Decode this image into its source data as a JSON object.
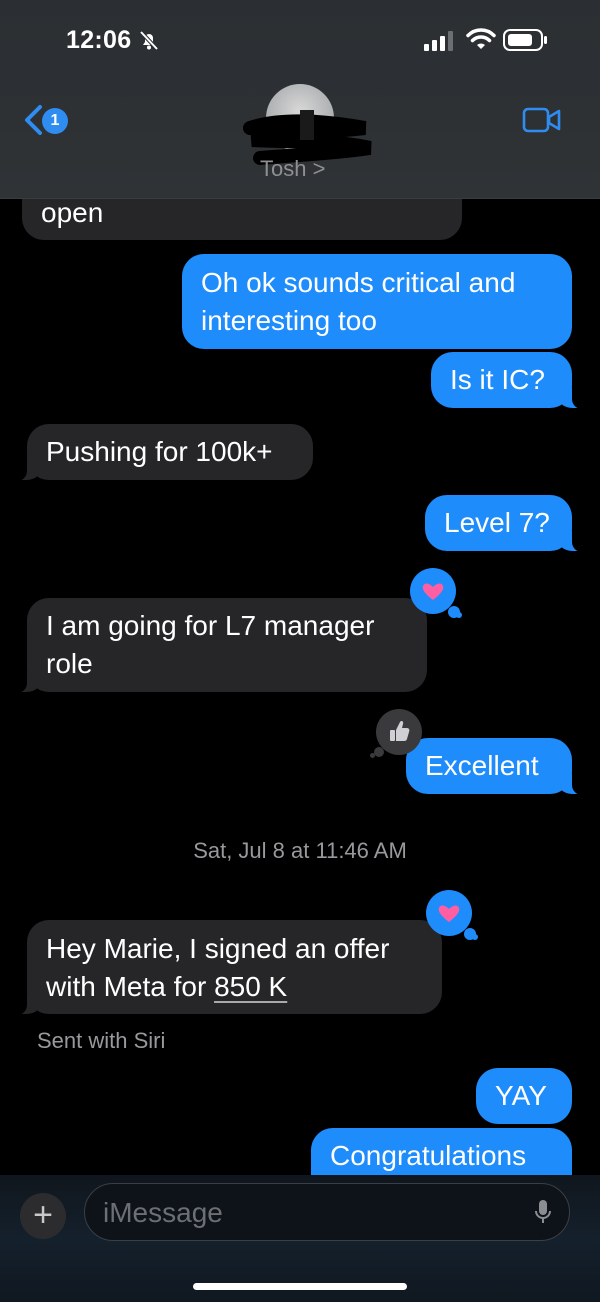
{
  "status_bar": {
    "time": "12:06"
  },
  "header": {
    "back_badge": "1",
    "contact_name": "Tosh >"
  },
  "messages": [
    {
      "side": "in",
      "text": "open"
    },
    {
      "side": "out",
      "text": "Oh ok sounds critical and interesting too"
    },
    {
      "side": "out",
      "text": "Is it IC?"
    },
    {
      "side": "in",
      "text": "Pushing for 100k+"
    },
    {
      "side": "out",
      "text": "Level 7?"
    },
    {
      "side": "in",
      "text": "I am going for L7 manager role",
      "tapback": "heart"
    },
    {
      "side": "out",
      "text": "Excellent",
      "tapback": "thumbs-up"
    },
    {
      "side": "in",
      "text_prefix": "Hey Marie, I signed an offer with Meta for ",
      "text_link": "850 K",
      "tapback": "heart",
      "footnote": "Sent with Siri"
    },
    {
      "side": "out",
      "text": "YAY"
    },
    {
      "side": "out",
      "text": "Congratulations"
    }
  ],
  "timestamp": "Sat, Jul 8 at 11:46 AM",
  "composer": {
    "plus_label": "+",
    "placeholder": "iMessage"
  },
  "colors": {
    "outgoing_bubble": "#1f8cfc",
    "incoming_bubble": "#262628",
    "heart": "#ff5fa2"
  },
  "icons": [
    "mute-bell-icon",
    "signal-icon",
    "wifi-icon",
    "battery-icon",
    "back-chevron-icon",
    "video-call-icon",
    "heart-icon",
    "thumbs-up-icon",
    "microphone-icon"
  ]
}
